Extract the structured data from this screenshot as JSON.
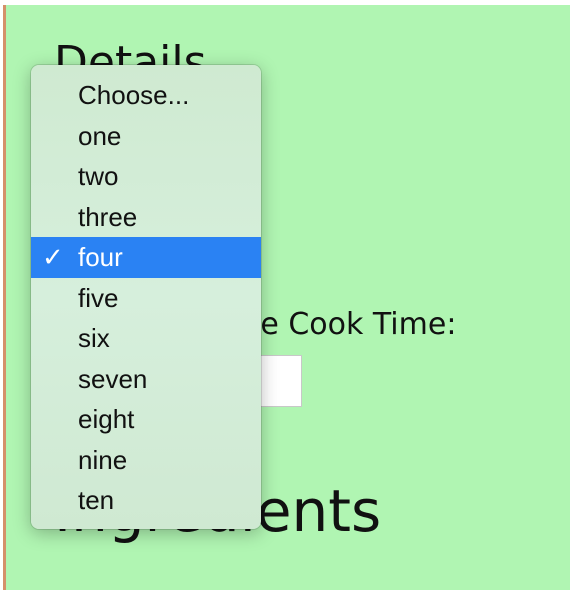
{
  "page": {
    "details_heading": "Details",
    "cook_time_label": "Active Cook Time:",
    "cook_time_value": "",
    "ingredients_heading": "Ingredients"
  },
  "dropdown": {
    "selected": "four",
    "check_glyph": "✓",
    "options": [
      {
        "label": "Choose..."
      },
      {
        "label": "one"
      },
      {
        "label": "two"
      },
      {
        "label": "three"
      },
      {
        "label": "four"
      },
      {
        "label": "five"
      },
      {
        "label": "six"
      },
      {
        "label": "seven"
      },
      {
        "label": "eight"
      },
      {
        "label": "nine"
      },
      {
        "label": "ten"
      }
    ]
  },
  "colors": {
    "background": "#b0f5b2",
    "selection": "#2a82f3",
    "left_border": "#d4906a"
  }
}
